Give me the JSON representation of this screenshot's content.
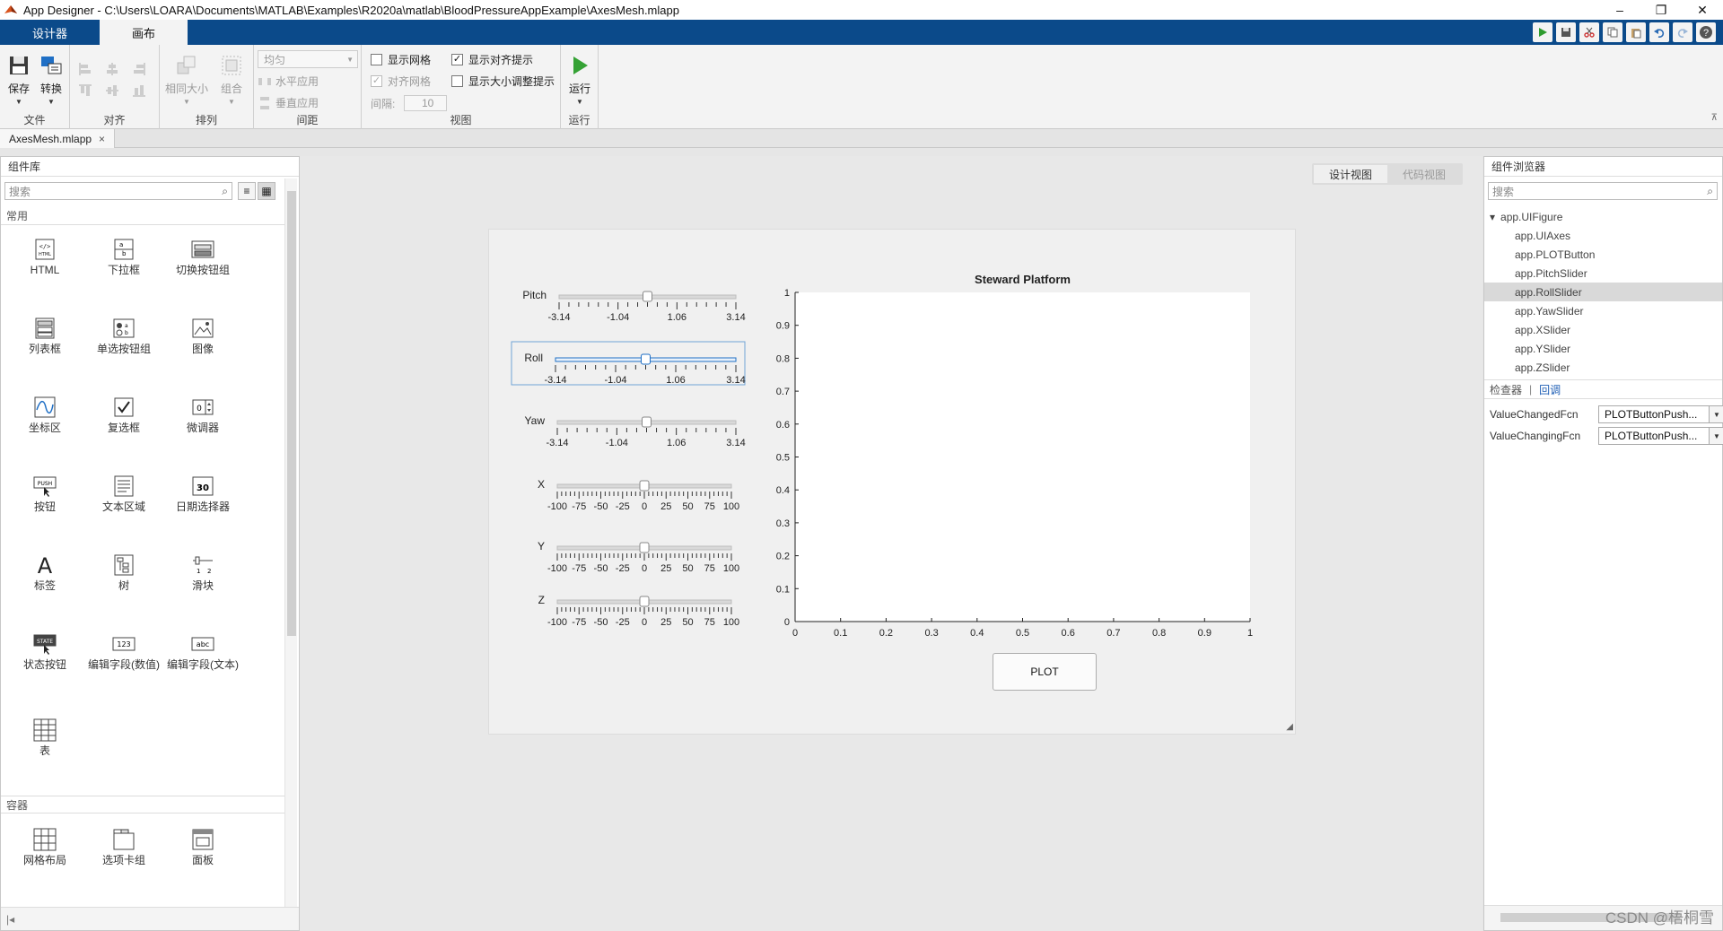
{
  "window": {
    "title": "App Designer - C:\\Users\\LOARA\\Documents\\MATLAB\\Examples\\R2020a\\matlab\\BloodPressureAppExample\\AxesMesh.mlapp",
    "controls": [
      "–",
      "❐",
      "✕"
    ]
  },
  "ribbon_tabs": [
    {
      "label": "设计器",
      "active": false
    },
    {
      "label": "画布",
      "active": true
    }
  ],
  "quick_toolbar": [
    "run-icon",
    "save-icon",
    "cut-icon",
    "copy-icon",
    "paste-icon",
    "undo-icon",
    "redo-icon",
    "help-icon"
  ],
  "ribbon": {
    "file": {
      "label": "文件",
      "save": "保存",
      "convert": "转换"
    },
    "align": {
      "label": "对齐"
    },
    "arrange": {
      "label": "排列",
      "same_size": "相同大小",
      "group": "组合"
    },
    "spacing": {
      "label": "间距",
      "mode": "均匀",
      "horizontal": "水平应用",
      "vertical": "垂直应用"
    },
    "view": {
      "label": "视图",
      "show_grid": "显示网格",
      "snap_to_grid": "对齐网格",
      "spacing_label": "间隔:",
      "spacing_value": "10",
      "show_alignment": "显示对齐提示",
      "show_resize": "显示大小调整提示"
    },
    "run": {
      "label": "运行",
      "button": "运行"
    }
  },
  "doc_tab": {
    "label": "AxesMesh.mlapp",
    "close": "×"
  },
  "component_library": {
    "title": "组件库",
    "search_placeholder": "搜索",
    "sections": [
      {
        "name": "常用",
        "items": [
          "HTML",
          "下拉框",
          "切换按钮组",
          "列表框",
          "单选按钮组",
          "图像",
          "坐标区",
          "复选框",
          "微调器",
          "按钮",
          "文本区域",
          "日期选择器",
          "标签",
          "树",
          "滑块",
          "状态按钮",
          "编辑字段(数值)",
          "编辑字段(文本)",
          "表"
        ]
      },
      {
        "name": "容器",
        "items": [
          "网格布局",
          "选项卡组",
          "面板"
        ]
      }
    ]
  },
  "view_toggle": {
    "design": "设计视图",
    "code": "代码视图"
  },
  "canvas": {
    "sliders": [
      {
        "name": "Pitch",
        "ticks": [
          "-3.14",
          "-1.04",
          "1.06",
          "3.14"
        ],
        "value": 0
      },
      {
        "name": "Roll",
        "ticks": [
          "-3.14",
          "-1.04",
          "1.06",
          "3.14"
        ],
        "value": 0,
        "selected": true
      },
      {
        "name": "Yaw",
        "ticks": [
          "-3.14",
          "-1.04",
          "1.06",
          "3.14"
        ],
        "value": 0
      },
      {
        "name": "X",
        "ticks": [
          "-100",
          "-75",
          "-50",
          "-25",
          "0",
          "25",
          "50",
          "75",
          "100"
        ],
        "value": 0
      },
      {
        "name": "Y",
        "ticks": [
          "-100",
          "-75",
          "-50",
          "-25",
          "0",
          "25",
          "50",
          "75",
          "100"
        ],
        "value": 0
      },
      {
        "name": "Z",
        "ticks": [
          "-100",
          "-75",
          "-50",
          "-25",
          "0",
          "25",
          "50",
          "75",
          "100"
        ],
        "value": 0
      }
    ],
    "plot_button": "PLOT"
  },
  "chart_data": {
    "type": "line",
    "title": "Steward Platform",
    "xlabel": "",
    "ylabel": "",
    "xlim": [
      0,
      1
    ],
    "ylim": [
      0,
      1
    ],
    "x_ticks": [
      "0",
      "0.1",
      "0.2",
      "0.3",
      "0.4",
      "0.5",
      "0.6",
      "0.7",
      "0.8",
      "0.9",
      "1"
    ],
    "y_ticks": [
      "0",
      "0.1",
      "0.2",
      "0.3",
      "0.4",
      "0.5",
      "0.6",
      "0.7",
      "0.8",
      "0.9",
      "1"
    ],
    "series": [],
    "grid": false
  },
  "component_browser": {
    "title": "组件浏览器",
    "search_placeholder": "搜索",
    "tree": [
      {
        "label": "app.UIFigure",
        "level": 0,
        "expanded": true
      },
      {
        "label": "app.UIAxes",
        "level": 1
      },
      {
        "label": "app.PLOTButton",
        "level": 1
      },
      {
        "label": "app.PitchSlider",
        "level": 1
      },
      {
        "label": "app.RollSlider",
        "level": 1,
        "selected": true
      },
      {
        "label": "app.YawSlider",
        "level": 1
      },
      {
        "label": "app.XSlider",
        "level": 1
      },
      {
        "label": "app.YSlider",
        "level": 1
      },
      {
        "label": "app.ZSlider",
        "level": 1
      }
    ],
    "inspector_tab": "检查器",
    "callback_tab": "回调",
    "callbacks": [
      {
        "name": "ValueChangedFcn",
        "value": "PLOTButtonPush..."
      },
      {
        "name": "ValueChangingFcn",
        "value": "PLOTButtonPush..."
      }
    ]
  },
  "watermark": "CSDN @梧桐雪"
}
